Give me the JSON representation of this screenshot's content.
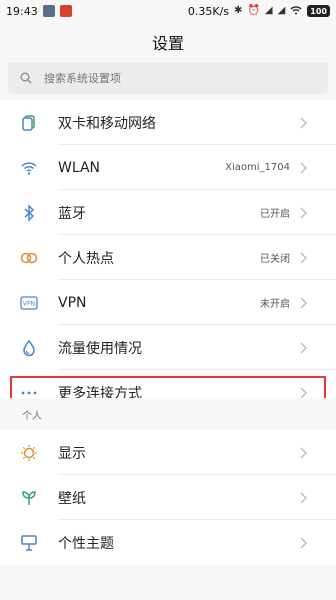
{
  "status_bar": {
    "time": "19:43",
    "network_speed": "0.35K/s",
    "battery": "100"
  },
  "header": {
    "title": "设置"
  },
  "search": {
    "placeholder": "搜索系统设置项"
  },
  "network_items": [
    {
      "label": "双卡和移动网络",
      "status": "",
      "icon": "sim-card-icon"
    },
    {
      "label": "WLAN",
      "status": "Xiaomi_1704",
      "icon": "wifi-icon"
    },
    {
      "label": "蓝牙",
      "status": "已开启",
      "icon": "bluetooth-icon"
    },
    {
      "label": "个人热点",
      "status": "已关闭",
      "icon": "hotspot-icon"
    },
    {
      "label": "VPN",
      "status": "未开启",
      "icon": "vpn-icon"
    },
    {
      "label": "流量使用情况",
      "status": "",
      "icon": "data-usage-icon"
    },
    {
      "label": "更多连接方式",
      "status": "",
      "icon": "more-connections-icon"
    }
  ],
  "section_personal": {
    "title": "个人"
  },
  "personal_items": [
    {
      "label": "显示",
      "icon": "display-icon"
    },
    {
      "label": "壁纸",
      "icon": "wallpaper-icon"
    },
    {
      "label": "个性主题",
      "icon": "theme-icon"
    }
  ],
  "colors": {
    "accent_red": "#e53935",
    "icon_blue": "#4a86c7",
    "icon_orange": "#e58b3a",
    "icon_green": "#3ba36a"
  }
}
